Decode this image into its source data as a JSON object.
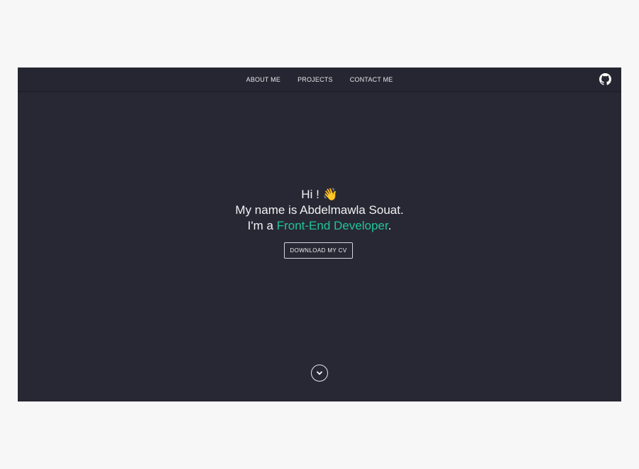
{
  "nav": {
    "items": [
      {
        "label": "ABOUT ME"
      },
      {
        "label": "PROJECTS"
      },
      {
        "label": "CONTACT ME"
      }
    ],
    "github_icon": "github-icon"
  },
  "hero": {
    "greeting": "Hi !",
    "wave_emoji": "👋",
    "name_line": "My name is Abdelmawla Souat.",
    "role_prefix": "I'm a",
    "role": "Front-End Developer",
    "role_suffix": ".",
    "cv_button": "DOWNLOAD MY CV"
  },
  "scroll": {
    "icon": "chevron-down-circle-icon"
  },
  "colors": {
    "background": "#282834",
    "navbar": "#262632",
    "accent": "#1fc49a",
    "text": "#f0f0f3",
    "page": "#f7f7f7"
  }
}
